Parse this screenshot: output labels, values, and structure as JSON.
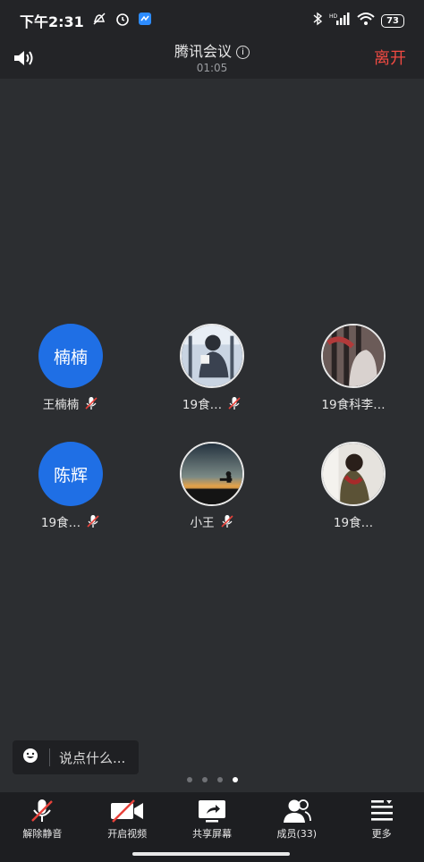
{
  "status": {
    "time": "下午2:31",
    "network": "HD",
    "battery": "73"
  },
  "meeting": {
    "title": "腾讯会议",
    "timer": "01:05",
    "leave": "离开"
  },
  "participants": [
    {
      "name": "王楠楠",
      "avatar_text": "楠楠",
      "avatar_color": "#1f6fe5",
      "muted": true
    },
    {
      "name": "19食…",
      "avatar_text": "",
      "muted": true
    },
    {
      "name": "19食科李…",
      "avatar_text": "",
      "muted": false
    },
    {
      "name": "19食…",
      "avatar_text": "陈辉",
      "avatar_color": "#1f6fe5",
      "muted": true
    },
    {
      "name": "小王",
      "avatar_text": "",
      "muted": true
    },
    {
      "name": "19食…",
      "avatar_text": "",
      "muted": false
    }
  ],
  "chat": {
    "placeholder": "说点什么..."
  },
  "pager": {
    "pages": 4,
    "active": 4
  },
  "toolbar": {
    "unmute": "解除静音",
    "video": "开启视频",
    "share": "共享屏幕",
    "members": "成员(33)",
    "more": "更多"
  },
  "colors": {
    "accent": "#1f6fe5",
    "leave": "#f04a42",
    "muted": "#e8413a"
  }
}
